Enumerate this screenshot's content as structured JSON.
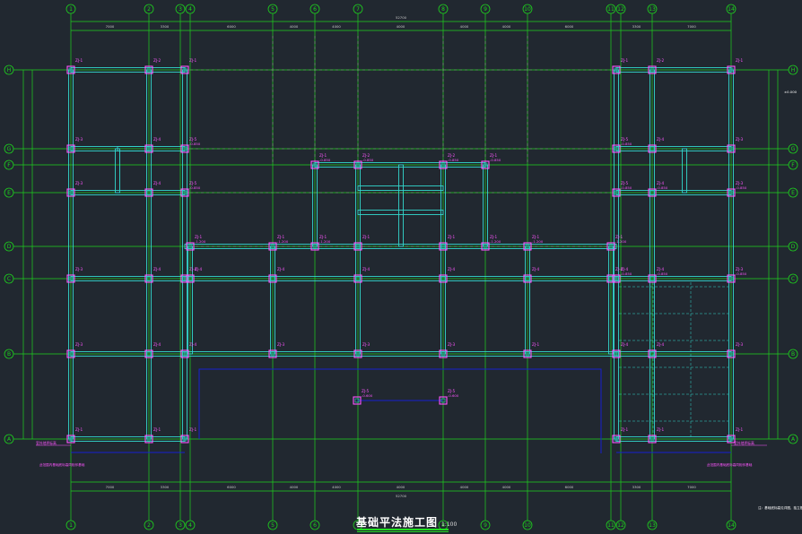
{
  "drawing": {
    "title": "基础平法施工图",
    "scale": "1:100",
    "grid_cols": [
      "1",
      "2",
      "3",
      "4",
      "5",
      "6",
      "7",
      "8",
      "9",
      "10",
      "11",
      "12",
      "13",
      "14"
    ],
    "grid_rows": [
      "H",
      "G",
      "F",
      "E",
      "D",
      "C",
      "B",
      "A"
    ],
    "dim_top": [
      "7000",
      "3300",
      "",
      "6000",
      "4000",
      "4000",
      "4000",
      "4000",
      "4000",
      "6000",
      "",
      "3300",
      "7000"
    ],
    "overall_dim": "52700",
    "elevation_note": "±0.000",
    "column_labels": {
      "zj1": "ZJ-1",
      "zj2": "ZJ-2",
      "zj3": "ZJ-3",
      "zj4": "ZJ-4",
      "zj5": "ZJ-5"
    },
    "elev_values": {
      "e1": "-0.850",
      "e2": "-1.200",
      "e3": "-0.600"
    },
    "notes": {
      "left": "室外地坪标高",
      "right": "室外地坪标高",
      "left_long": "此范围内基础底标高同相邻基础",
      "right_long": "此范围内基础底标高同相邻基础",
      "corner_note": "注：基础底标高见详图，独立基础编号见表"
    },
    "colors": {
      "bg": "#212830",
      "axis": "#1ed21e",
      "beam": "#32d6cc",
      "column": "#ff55ff",
      "dashed": "#8a8a8a",
      "blue": "#1820d0"
    }
  }
}
